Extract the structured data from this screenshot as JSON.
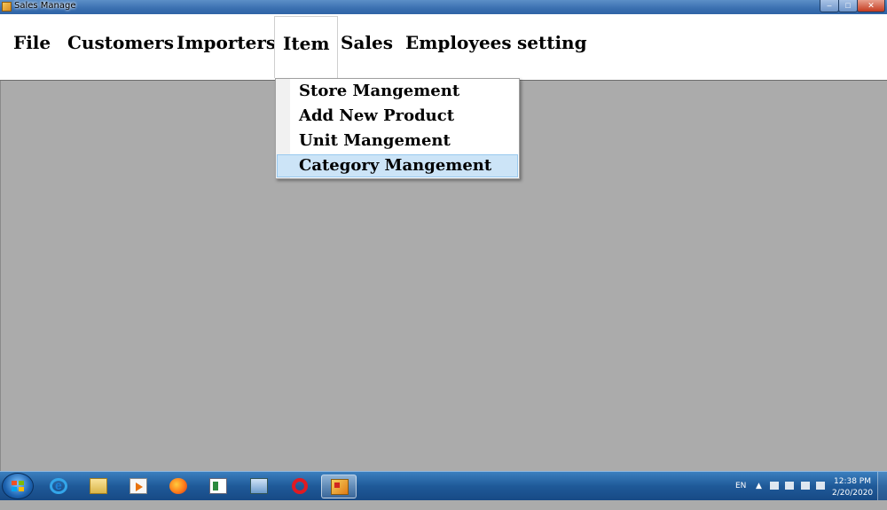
{
  "window": {
    "title": "Sales Manage"
  },
  "menubar": {
    "items": [
      {
        "label": "File"
      },
      {
        "label": "Customers"
      },
      {
        "label": "Importers"
      },
      {
        "label": "Item",
        "open": true
      },
      {
        "label": "Sales"
      },
      {
        "label": "Employees"
      },
      {
        "label": "setting"
      }
    ]
  },
  "dropdown": {
    "items": [
      {
        "label": "Store Mangement"
      },
      {
        "label": "Add New Product"
      },
      {
        "label": "Unit Mangement"
      },
      {
        "label": "Category Mangement",
        "highlighted": true
      }
    ]
  },
  "taskbar": {
    "apps": [
      "start-button",
      "internet-explorer",
      "file-explorer",
      "media-player",
      "firefox",
      "app-window",
      "computer",
      "opera",
      "sales-manage"
    ],
    "tray": {
      "language": "EN",
      "time": "12:38 PM",
      "date": "2/20/2020"
    }
  },
  "colors": {
    "highlight": "#cce4f7",
    "workspace": "#ababab",
    "taskbar": "#1f5a99"
  }
}
